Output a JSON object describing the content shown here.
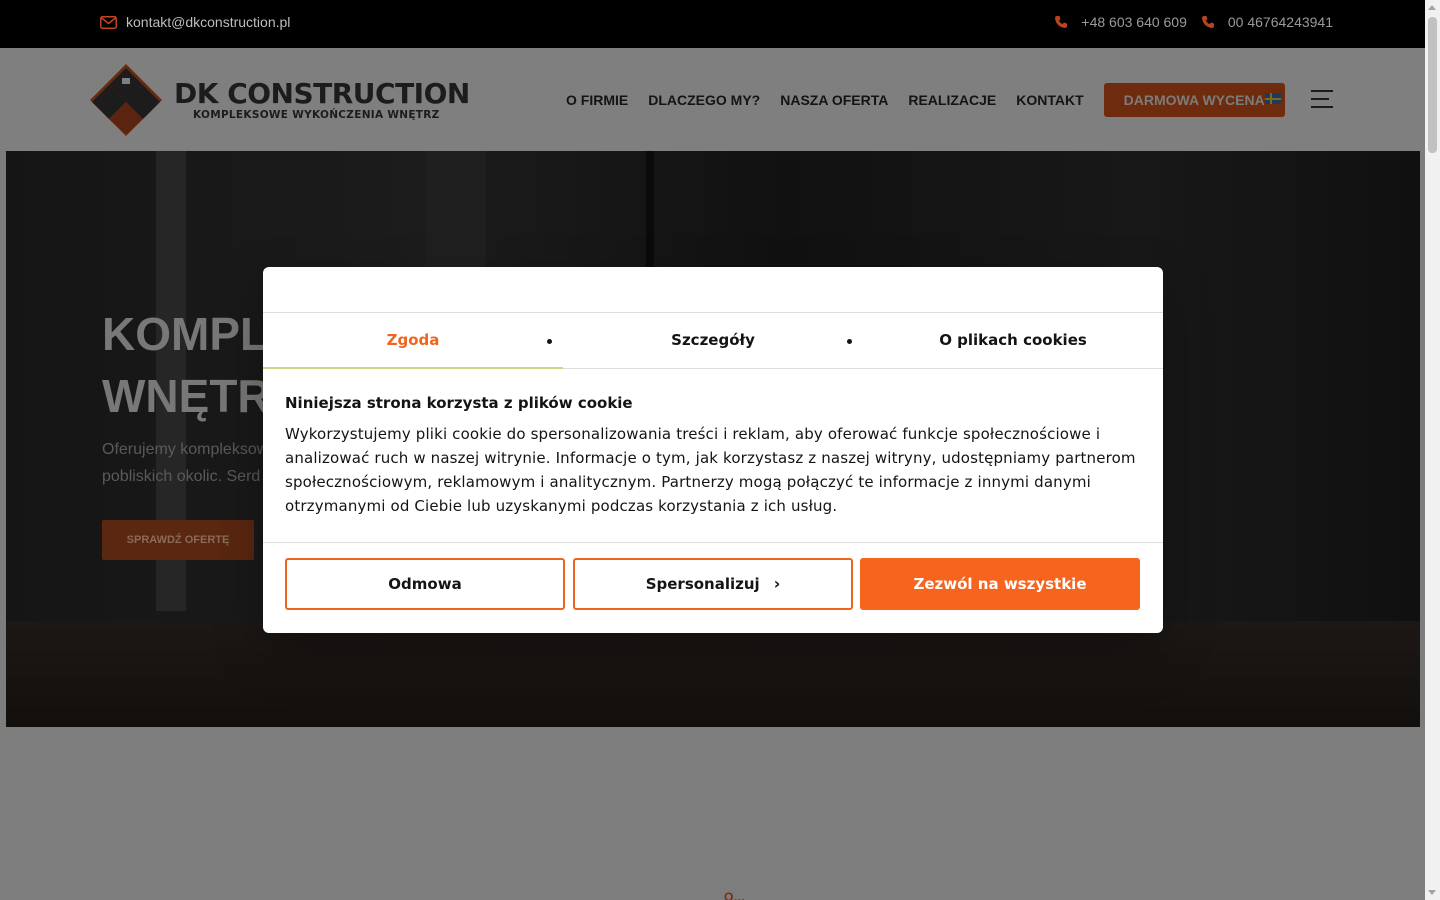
{
  "topbar": {
    "email": "kontakt@dkconstruction.pl",
    "phone1": "+48 603 640 609",
    "phone2": "00 46764243941",
    "icons": [
      "mail-icon",
      "phone-icon",
      "phone-icon"
    ]
  },
  "header": {
    "logo_title": "DK CONSTRUCTION",
    "logo_subtitle": "KOMPLEKSOWE WYKOŃCZENIA WNĘTRZ",
    "nav": [
      "O FIRMIE",
      "DLACZEGO MY?",
      "NASZA OFERTA",
      "REALIZACJE",
      "KONTAKT"
    ],
    "cta": "DARMOWA WYCENA",
    "language_flag": "swedish-flag-icon",
    "menu_icon": "hamburger-menu-icon"
  },
  "hero": {
    "title_line1": "KOMPLI",
    "title_line2": "WNĘTRZ",
    "text_line1": "Oferujemy  kompleksow",
    "text_line2": "pobliskich okolic. Serd",
    "button": "SPRAWDŹ OFERTĘ"
  },
  "below": {
    "label": "O…"
  },
  "cookie_dialog": {
    "tabs": [
      "Zgoda",
      "Szczegóły",
      "O plikach cookies"
    ],
    "active_tab": "Zgoda",
    "title": "Niniejsza strona korzysta z plików cookie",
    "body": "Wykorzystujemy pliki cookie do spersonalizowania treści i reklam, aby oferować funkcje społecznościowe i analizować ruch w naszej witrynie. Informacje o tym, jak korzystasz z naszej witryny, udostępniamy partnerom społecznościowym, reklamowym i analitycznym. Partnerzy mogą połączyć te informacje z innymi danymi otrzymanymi od Ciebie lub uzyskanymi podczas korzystania z ich usług.",
    "buttons": {
      "deny": "Odmowa",
      "customize": "Spersonalizuj",
      "allow_all": "Zezwól na wszystkie"
    }
  },
  "colors": {
    "accent": "#f6641e",
    "active_tab_underline": "#c7d98a"
  }
}
